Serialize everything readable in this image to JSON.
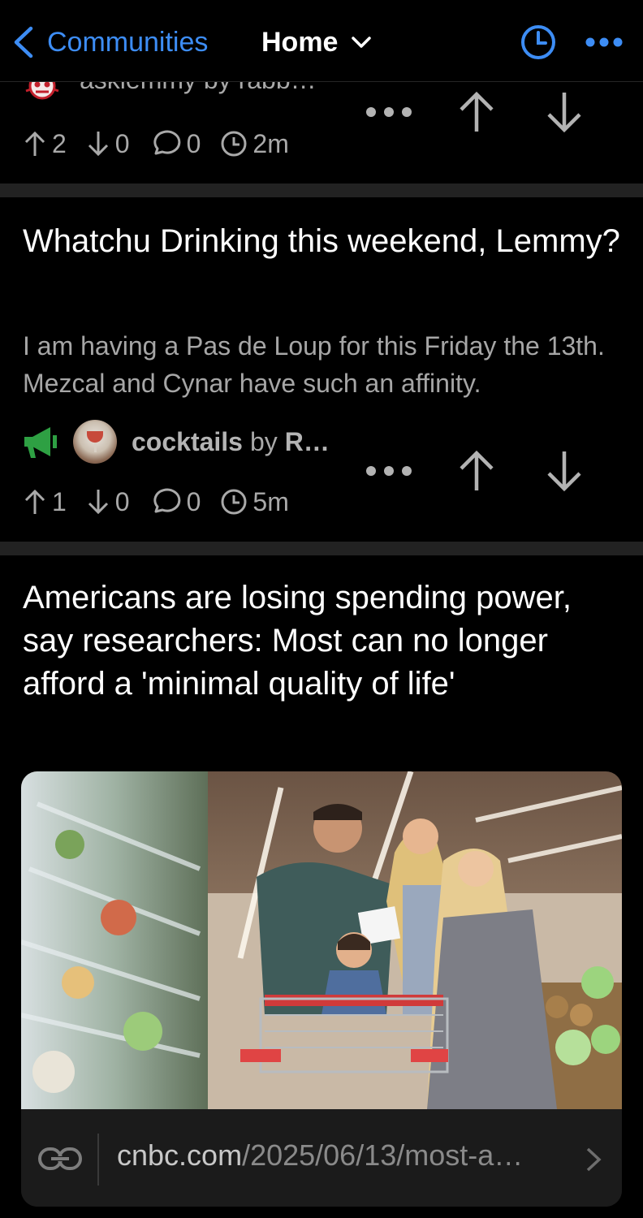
{
  "topbar": {
    "back_label": "Communities",
    "home_label": "Home",
    "accent": "#3d8df5"
  },
  "post1": {
    "community_partial": "asklemmy by rabb…",
    "upvotes": "2",
    "downvotes": "0",
    "comments": "0",
    "age": "2m"
  },
  "post2": {
    "title": "Whatchu Drinking this weekend, Lemmy?",
    "body": "I am having a Pas de Loup for this Friday the 13th. Mezcal and Cynar have such an affinity.",
    "community": "cocktails",
    "by": "by",
    "user": "R…",
    "upvotes": "1",
    "downvotes": "0",
    "comments": "0",
    "age": "5m",
    "announce_color": "#2ea043"
  },
  "post3": {
    "title": "Americans are losing spending power, say researchers: Most can no longer afford a 'minimal quality of life'",
    "link_domain": "cnbc.com",
    "link_path": "/2025/06/13/most-a…"
  },
  "icons": {
    "back": "chevron-left-icon",
    "dropdown": "chevron-down-icon",
    "history": "clock-icon",
    "more": "ellipsis-icon",
    "upvote": "arrow-up-icon",
    "downvote": "arrow-down-icon",
    "comment": "speech-bubble-icon",
    "link": "link-icon",
    "announce": "megaphone-icon"
  }
}
